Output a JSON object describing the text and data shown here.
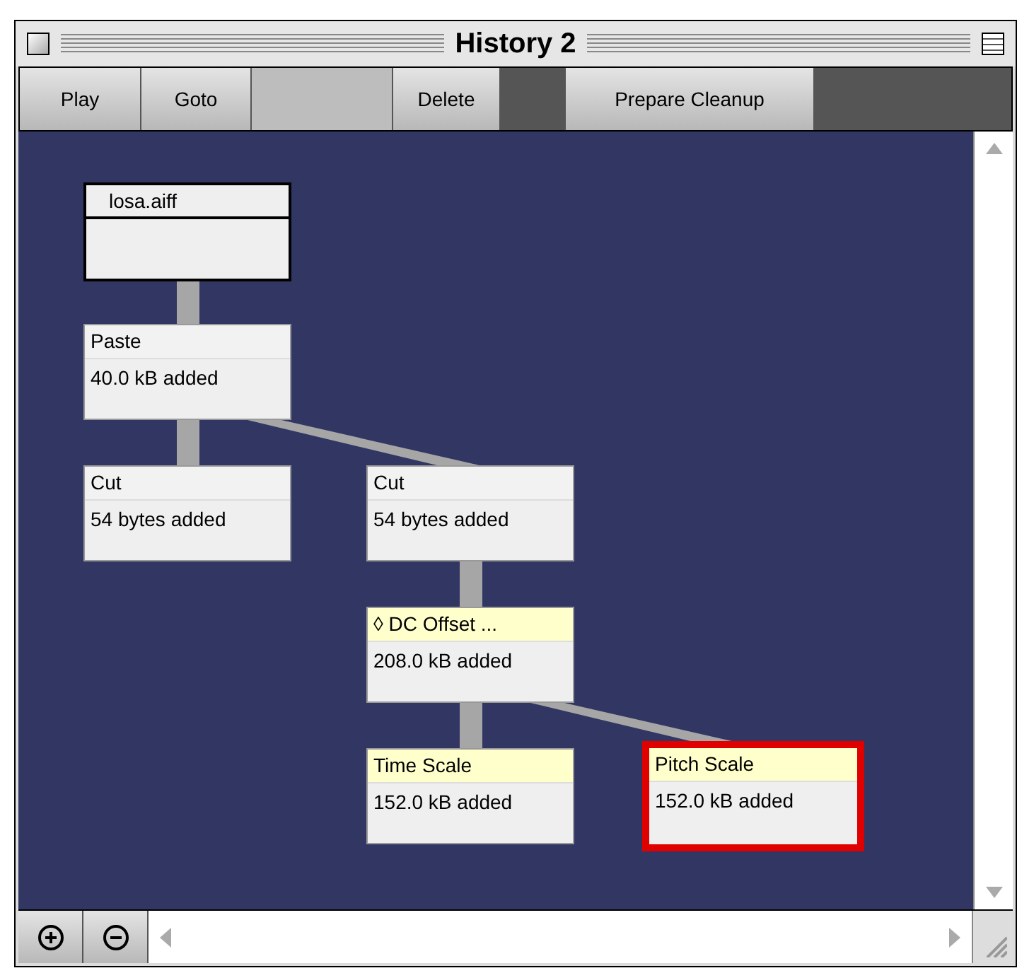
{
  "window": {
    "title": "History 2"
  },
  "toolbar": [
    {
      "label": "Play"
    },
    {
      "label": "Goto"
    },
    {
      "label": "Delete"
    },
    {
      "label": "Prepare Cleanup"
    }
  ],
  "history": {
    "kind": "file",
    "title": "losa.aiff",
    "selected": false,
    "children": [
      {
        "kind": "edit",
        "title": "Paste",
        "detail": "40.0 kB added",
        "selected": false,
        "children": [
          {
            "kind": "edit",
            "title": "Cut",
            "detail": "54 bytes added",
            "selected": false
          },
          {
            "kind": "edit",
            "title": "Cut",
            "detail": "54 bytes added",
            "selected": false,
            "children": [
              {
                "kind": "effect",
                "title": "◊ DC Offset ...",
                "detail": "208.0 kB added",
                "selected": false,
                "children": [
                  {
                    "kind": "effect",
                    "title": "Time Scale",
                    "detail": "152.0 kB added",
                    "selected": false
                  },
                  {
                    "kind": "effect",
                    "title": "Pitch Scale",
                    "detail": "152.0 kB added",
                    "selected": true
                  }
                ]
              }
            ]
          }
        ]
      }
    ]
  }
}
